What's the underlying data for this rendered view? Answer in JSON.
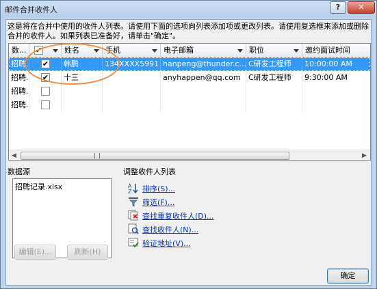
{
  "window": {
    "title": "邮件合并收件人",
    "help": "?",
    "close": "✕"
  },
  "description": "这是将在合并中使用的收件人列表。请使用下面的选项向列表添加项或更改列表。请使用复选框来添加或删除合并的收件人。如果列表已准备好，请单击\"确定\"。",
  "grid": {
    "columns": [
      "数...",
      "",
      "姓名",
      "手机",
      "电子邮箱",
      "职位",
      "邀约面试时间"
    ],
    "rows": [
      {
        "source": "招聘...",
        "checked": true,
        "name": "韩鹏",
        "phone": "134XXXX5991",
        "email": "hanpeng@thunder.c...",
        "position": "C研发工程师",
        "time": "10:00:00 AM",
        "selected": true
      },
      {
        "source": "招聘...",
        "checked": true,
        "name": "十三",
        "phone": "",
        "email": "anyhappen@qq.com",
        "position": "C研发工程师",
        "time": "9:30:00 AM",
        "selected": false
      },
      {
        "source": "招聘...",
        "checked": false,
        "name": "",
        "phone": "",
        "email": "",
        "position": "",
        "time": "",
        "selected": false
      },
      {
        "source": "招聘...",
        "checked": false,
        "name": "",
        "phone": "",
        "email": "",
        "position": "",
        "time": "",
        "selected": false
      }
    ],
    "scroll_left": "◀",
    "scroll_right": "▶"
  },
  "datasource": {
    "label": "数据源",
    "items": [
      "招聘记录.xlsx"
    ],
    "edit": "编辑(E)...",
    "refresh": "刷新(H)"
  },
  "adjust": {
    "label": "调整收件人列表",
    "links": [
      "排序(S)...",
      "筛选(F)...",
      "查找重复收件人(D)...",
      "查找收件人(N)...",
      "验证地址(V)..."
    ]
  },
  "ok": "确定",
  "colors": {
    "selection": "#3399ff",
    "link": "#0033cc",
    "annotation": "#ee8c3a"
  }
}
